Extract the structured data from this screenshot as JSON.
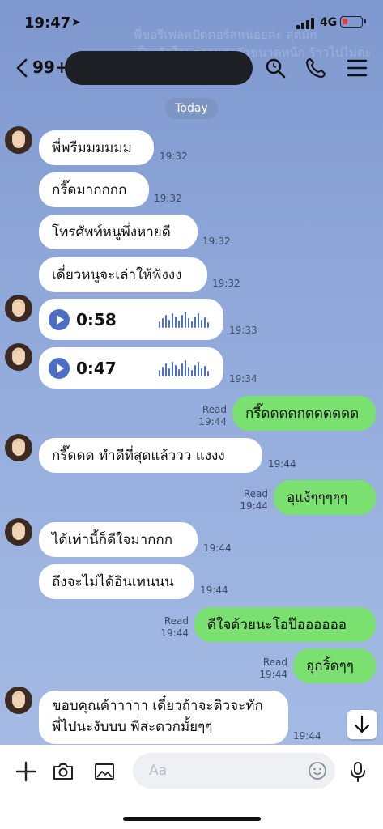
{
  "status_bar": {
    "time": "19:47",
    "network": "4G"
  },
  "background_text": "พี่ขอรีเฟลคปัดคอร์สหน่อยค่ะ สุดมัก\nเป็นเจ้าใจแต่งจนส่งตัวขนาดหน้ก ร้าวไปไม่ดะ",
  "header": {
    "unread_count": "99+",
    "icons": [
      "back-chevron-icon",
      "search-icon",
      "phone-icon",
      "menu-icon"
    ]
  },
  "date_separator": "Today",
  "messages": [
    {
      "text": "พี่พรีมมมมมม",
      "time": "19:32"
    },
    {
      "text": "กรี๊ดมากกกก",
      "time": "19:32"
    },
    {
      "text": "โทรศัพท์หนูพึ่งหายดี",
      "time": "19:32"
    },
    {
      "text": "เดี๋ยวหนูจะเล่าให้ฟังงง",
      "time": "19:32"
    },
    {
      "voice_duration": "0:58",
      "time": "19:33"
    },
    {
      "voice_duration": "0:47",
      "time": "19:34"
    },
    {
      "text": "กรี๊ดดดดกดดดดดด",
      "read": "Read",
      "time": "19:44"
    },
    {
      "text": "กรี๊ดดด ทำดีที่สุดแล้ววว แงงง",
      "time": "19:44"
    },
    {
      "text": "อุแง้ๆๆๆๆๆ",
      "read": "Read",
      "time": "19:44"
    },
    {
      "text": "ได้เท่านี้ก็ดีใจมากกก",
      "time": "19:44"
    },
    {
      "text": "ถึงจะไม่ได้อินเทนนน",
      "time": "19:44"
    },
    {
      "text": "ดีใจด้วยนะโอป๊ออออออ",
      "read": "Read",
      "time": "19:44"
    },
    {
      "text": "อุกริ้ดๆๆ",
      "read": "Read",
      "time": "19:44"
    },
    {
      "text": "ขอบคุณค้าาาาา เดี๋ยวถ้าจะติวจะทัก\nพี่ไปนะงับบบ พี่สะดวกมั้ยๆๆ",
      "time": "19:44"
    }
  ],
  "input": {
    "placeholder": "Aa"
  },
  "colors": {
    "incoming": "#ffffff",
    "outgoing": "#7ae06f",
    "accent": "#4b6fc6"
  }
}
